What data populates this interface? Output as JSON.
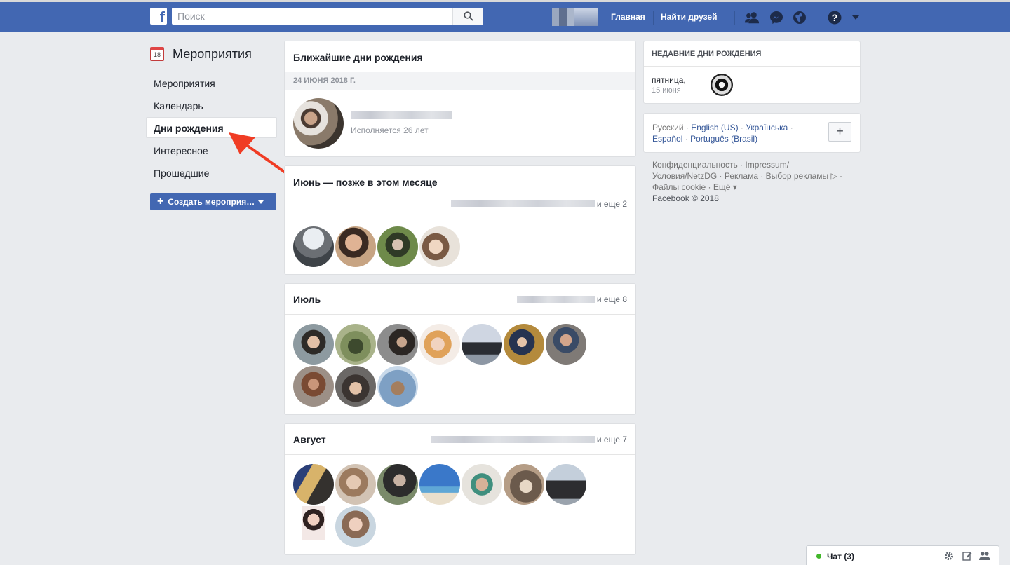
{
  "header": {
    "logo": "f",
    "search_placeholder": "Поиск",
    "nav_home": "Главная",
    "nav_find_friends": "Найти друзей"
  },
  "sidebar": {
    "calendar_day": "18",
    "title": "Мероприятия",
    "items": [
      {
        "label": "Мероприятия"
      },
      {
        "label": "Календарь"
      },
      {
        "label": "Дни рождения"
      },
      {
        "label": "Интересное"
      },
      {
        "label": "Прошедшие"
      }
    ],
    "create_button": "Создать мероприя…"
  },
  "upcoming": {
    "title": "Ближайшие дни рождения",
    "date": "24 ИЮНЯ 2018 Г.",
    "person_age": "Исполняется 26 лет"
  },
  "june": {
    "title": "Июнь — позже в этом месяце",
    "more": "и еще 2",
    "avatar_count": 4
  },
  "july": {
    "title": "Июль",
    "more": "и еще 8",
    "avatar_count": 10
  },
  "august": {
    "title": "Август",
    "more": "и еще 7",
    "avatar_count": 9
  },
  "recent": {
    "title": "НЕДАВНИЕ ДНИ РОЖДЕНИЯ",
    "day": "пятница,",
    "date": "15 июня"
  },
  "languages": {
    "current": "Русский",
    "links": [
      "English (US)",
      "Українська",
      "Español",
      "Português (Brasil)"
    ],
    "add": "+"
  },
  "footer": {
    "line1": "Конфиденциальность · Impressum/",
    "line2": "Условия/NetzDG · Реклама · Выбор рекламы ▷ ·",
    "line3": "Файлы cookie · Ещё ▾",
    "line4": "Facebook © 2018"
  },
  "chat": {
    "label": "Чат (3)"
  },
  "colors": {
    "brand": "#4267b2",
    "background": "#e9ebee",
    "online": "#42b72a",
    "arrow": "#f03c24"
  }
}
